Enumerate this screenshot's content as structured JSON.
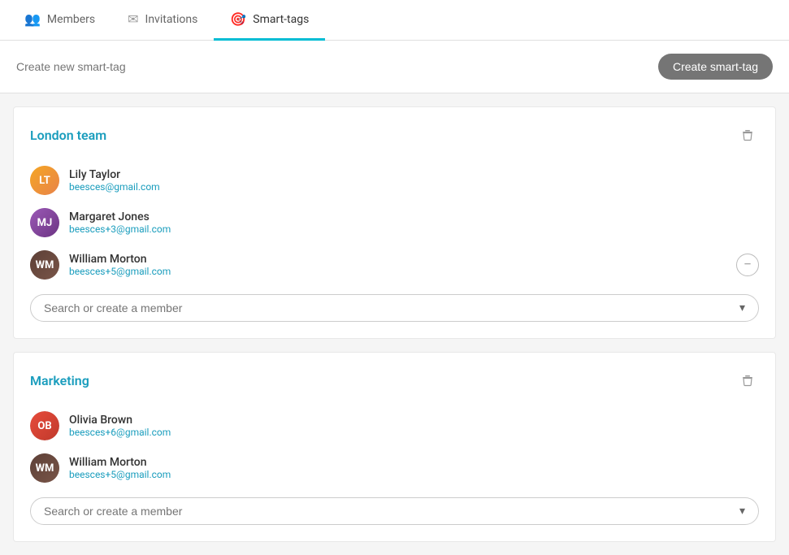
{
  "tabs": [
    {
      "id": "members",
      "label": "Members",
      "icon": "👥",
      "active": false
    },
    {
      "id": "invitations",
      "label": "Invitations",
      "icon": "✉",
      "active": false
    },
    {
      "id": "smart-tags",
      "label": "Smart-tags",
      "icon": "🎯",
      "active": true
    }
  ],
  "create_bar": {
    "placeholder": "Create new smart-tag",
    "button_label": "Create smart-tag"
  },
  "tag_groups": [
    {
      "id": "london-team",
      "title": "London team",
      "members": [
        {
          "id": "lily-taylor",
          "name": "Lily Taylor",
          "email": "beesces@gmail.com",
          "initials": "LT",
          "color": "#f5a623"
        },
        {
          "id": "margaret-jones",
          "name": "Margaret Jones",
          "email": "beesces+3@gmail.com",
          "initials": "MJ",
          "color": "#9b59b6"
        },
        {
          "id": "william-morton-1",
          "name": "William Morton",
          "email": "beesces+5@gmail.com",
          "initials": "WM",
          "color": "#5d4037",
          "hovered": true
        }
      ],
      "search_placeholder": "Search or create a member"
    },
    {
      "id": "marketing",
      "title": "Marketing",
      "members": [
        {
          "id": "olivia-brown",
          "name": "Olivia Brown",
          "email": "beesces+6@gmail.com",
          "initials": "OB",
          "color": "#e74c3c"
        },
        {
          "id": "william-morton-2",
          "name": "William Morton",
          "email": "beesces+5@gmail.com",
          "initials": "WM",
          "color": "#5d4037"
        }
      ],
      "search_placeholder": "Search or create a member"
    }
  ]
}
